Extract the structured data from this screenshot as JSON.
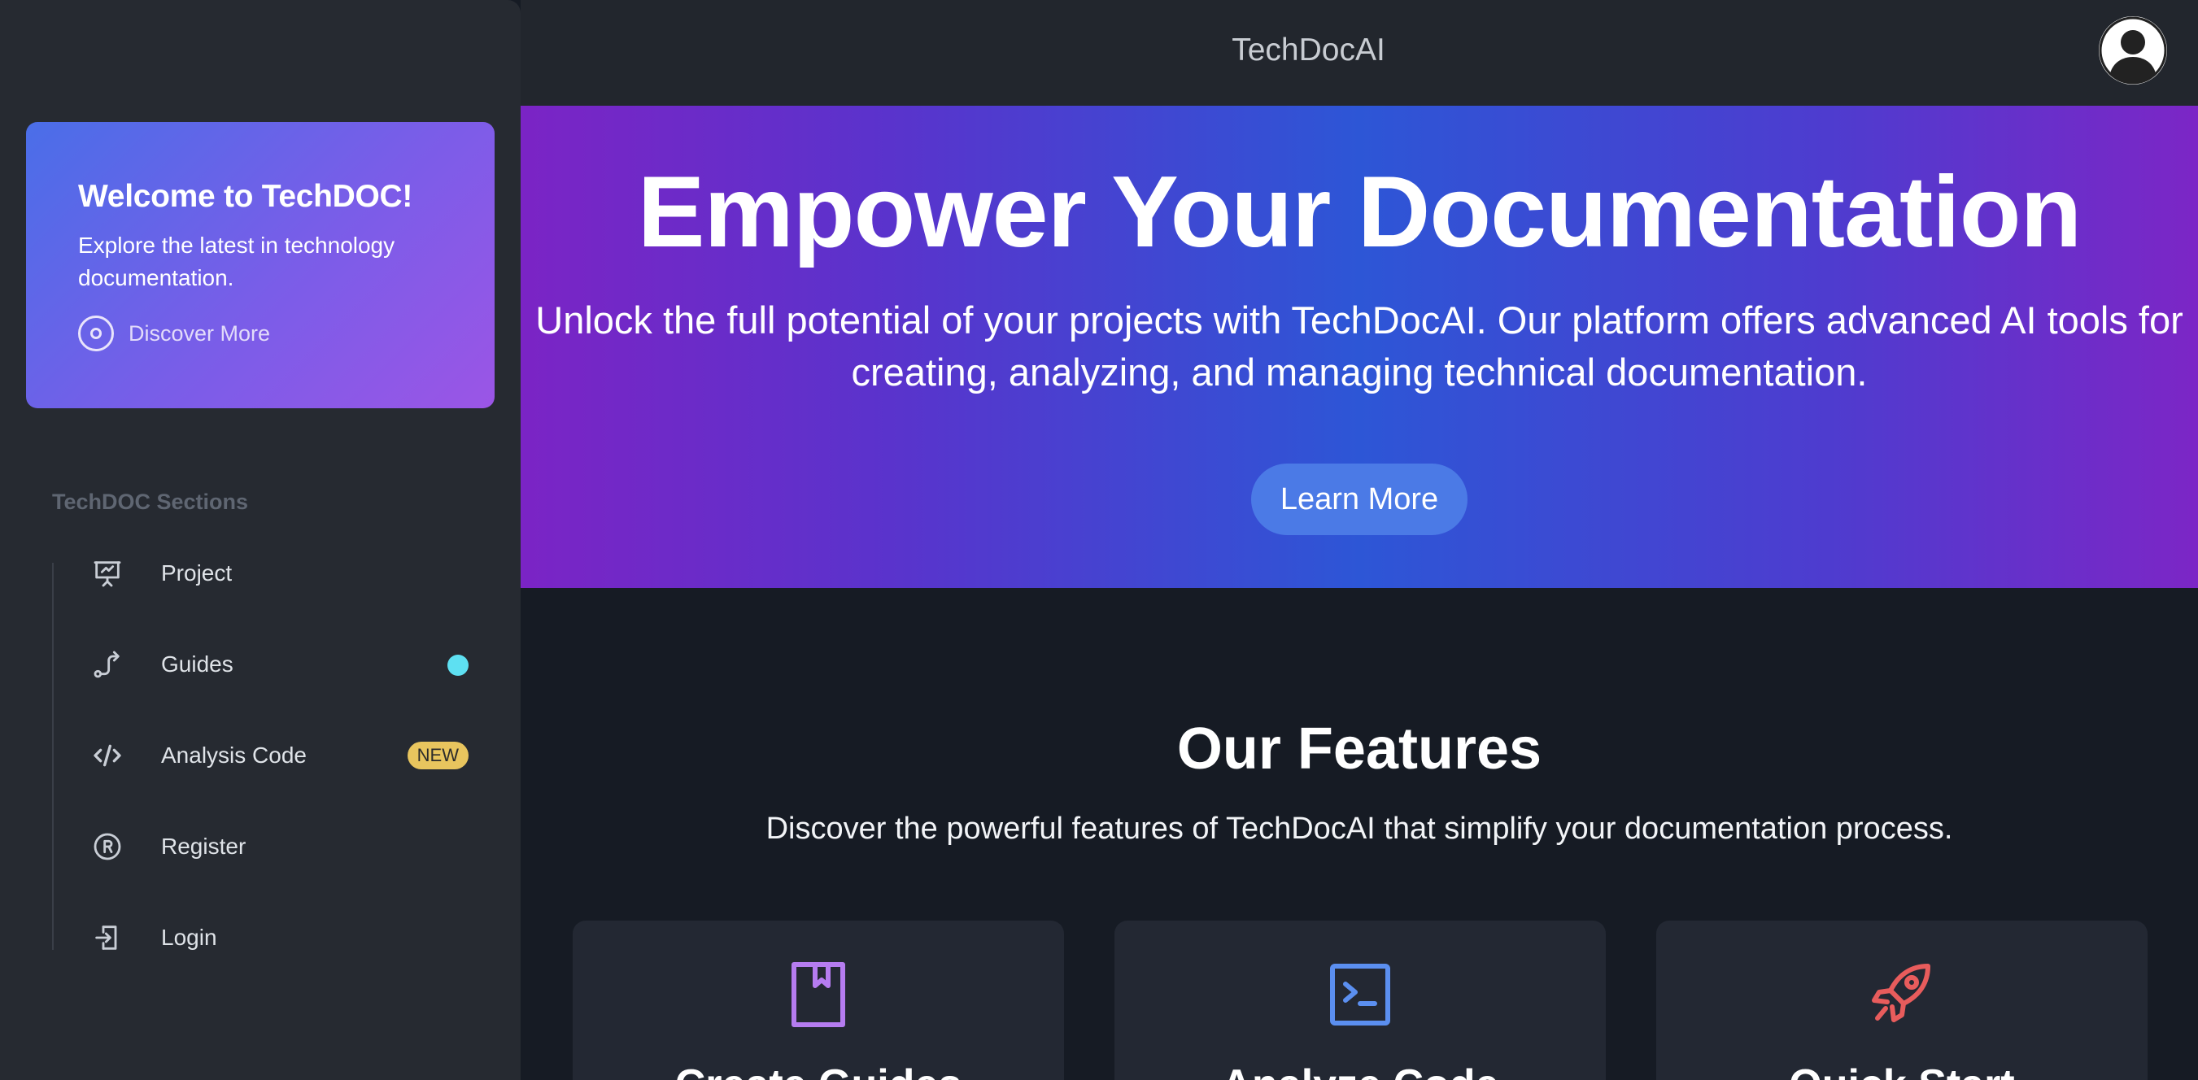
{
  "header": {
    "app_title": "TechDocAI",
    "avatar_icon": "user-avatar-icon"
  },
  "sidebar": {
    "welcome": {
      "title": "Welcome to TechDOC!",
      "text": "Explore the latest in technology documentation.",
      "link_label": "Discover More"
    },
    "section_title": "TechDOC Sections",
    "items": [
      {
        "label": "Project",
        "icon": "presentation-chart-icon"
      },
      {
        "label": "Guides",
        "icon": "route-icon",
        "indicator": "dot"
      },
      {
        "label": "Analysis Code",
        "icon": "code-icon",
        "badge": "NEW"
      },
      {
        "label": "Register",
        "icon": "registered-icon"
      },
      {
        "label": "Login",
        "icon": "login-icon"
      }
    ]
  },
  "hero": {
    "title": "Empower Your Documentation",
    "subtitle": "Unlock the full potential of your projects with TechDocAI. Our platform offers advanced AI tools for creating, analyzing, and managing technical documentation.",
    "cta_label": "Learn More"
  },
  "features": {
    "title": "Our Features",
    "subtitle": "Discover the powerful features of TechDocAI that simplify your documentation process.",
    "cards": [
      {
        "title": "Create Guides",
        "icon": "book-icon",
        "color": "#b57cf0"
      },
      {
        "title": "Analyze Code",
        "icon": "terminal-icon",
        "color": "#5b8ff0"
      },
      {
        "title": "Quick Start",
        "icon": "rocket-icon",
        "color": "#e85c5c"
      }
    ]
  },
  "colors": {
    "accent_blue": "#4b7ae6",
    "status_dot": "#5ee0f2",
    "badge_yellow": "#e8c55e"
  }
}
